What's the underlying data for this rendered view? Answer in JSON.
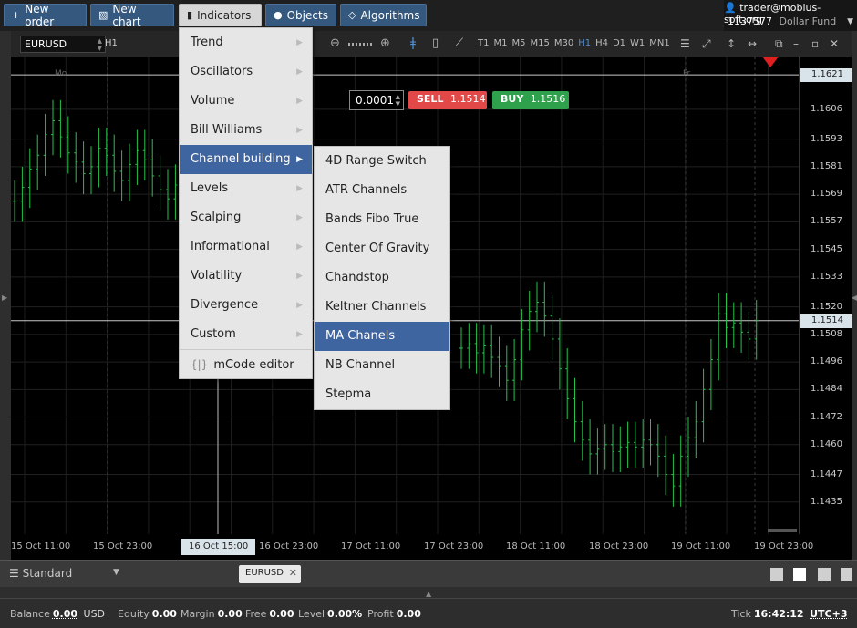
{
  "toolbar": {
    "new_order": "New order",
    "new_chart": "New chart",
    "indicators": "Indicators",
    "objects": "Objects",
    "algorithms": "Algorithms"
  },
  "account": {
    "user": "trader@mobius-soft.org",
    "id": "1137577",
    "fund": "Dollar Fund"
  },
  "chart": {
    "symbol": "EURUSD",
    "timeframe": "H1",
    "timeframes": [
      "T1",
      "M1",
      "M5",
      "M15",
      "M30",
      "H1",
      "H4",
      "D1",
      "W1",
      "MN1"
    ],
    "selected_timeframe": "H1",
    "lot": "0.0001",
    "sell_label": "SELL",
    "sell_price": "1.1514",
    "buy_label": "BUY",
    "buy_price": "1.1516",
    "price_ticks": [
      "1.1606",
      "1.1593",
      "1.1581",
      "1.1569",
      "1.1557",
      "1.1545",
      "1.1533",
      "1.1520",
      "1.1508",
      "1.1496",
      "1.1484",
      "1.1472",
      "1.1460",
      "1.1447",
      "1.1435"
    ],
    "price_tag_high": "1.1621",
    "price_tag_current": "1.1514",
    "time_ticks": [
      "15 Oct 11:00",
      "15 Oct 23:00",
      "16 Oct 23:00",
      "17 Oct 11:00",
      "17 Oct 23:00",
      "18 Oct 11:00",
      "18 Oct 23:00",
      "19 Oct 11:00",
      "19 Oct 23:00"
    ],
    "time_cursor": "16 Oct 15:00",
    "day_labels": [
      "Mo",
      "Fr"
    ],
    "colors": {
      "candle": "#27c24a",
      "sell": "#e24848",
      "buy": "#2fa14c",
      "menu_highlight": "#3f65a0"
    }
  },
  "chart_data": {
    "type": "bar",
    "title": "",
    "symbol": "EURUSD",
    "timeframe": "H1",
    "ylim": [
      1.1425,
      1.1625
    ],
    "x_ticks": [
      "15 Oct 11:00",
      "15 Oct 23:00",
      "16 Oct 23:00",
      "17 Oct 11:00",
      "17 Oct 23:00",
      "18 Oct 11:00",
      "18 Oct 23:00",
      "19 Oct 11:00",
      "19 Oct 23:00"
    ],
    "y_ticks": [
      1.1606,
      1.1593,
      1.1581,
      1.1569,
      1.1557,
      1.1545,
      1.1533,
      1.152,
      1.1508,
      1.1496,
      1.1484,
      1.1472,
      1.146,
      1.1447,
      1.1435
    ],
    "ohlc_close": [
      1.1566,
      1.1572,
      1.158,
      1.1586,
      1.1595,
      1.1601,
      1.1594,
      1.1587,
      1.1583,
      1.1578,
      1.1581,
      1.1589,
      1.1586,
      1.1579,
      1.1575,
      1.1582,
      1.1588,
      1.1584,
      1.1577,
      1.1571,
      1.1567,
      1.1573
    ],
    "ohlc_close_right": [
      1.1502,
      1.1504,
      1.15,
      1.1503,
      1.1498,
      1.1494,
      1.1488,
      1.1497,
      1.151,
      1.1518,
      1.1522,
      1.1516,
      1.1506,
      1.1493,
      1.148,
      1.147,
      1.1462,
      1.1456,
      1.1458,
      1.146,
      1.1457,
      1.1459,
      1.1461,
      1.1459,
      1.1462,
      1.146,
      1.1455,
      1.1447,
      1.1442,
      1.1455,
      1.1463,
      1.147,
      1.1484,
      1.1497,
      1.1517,
      1.1511,
      1.1513,
      1.1509,
      1.1506,
      1.1514
    ],
    "current_price": 1.1514,
    "reference_price": 1.1621
  },
  "menus": {
    "indicators": [
      {
        "label": "Trend"
      },
      {
        "label": "Oscillators"
      },
      {
        "label": "Volume"
      },
      {
        "label": "Bill Williams"
      },
      {
        "label": "Channel building"
      },
      {
        "label": "Levels"
      },
      {
        "label": "Scalping"
      },
      {
        "label": "Informational"
      },
      {
        "label": "Volatility"
      },
      {
        "label": "Divergence"
      },
      {
        "label": "Custom"
      }
    ],
    "indicators_selected": "Channel building",
    "mcode": "mCode editor",
    "channel_building": [
      {
        "label": "4D Range Switch"
      },
      {
        "label": "ATR Channels"
      },
      {
        "label": "Bands Fibo True"
      },
      {
        "label": "Center Of Gravity"
      },
      {
        "label": "Chandstop"
      },
      {
        "label": "Keltner Channels"
      },
      {
        "label": "MA Chanels"
      },
      {
        "label": "NB Channel"
      },
      {
        "label": "Stepma"
      }
    ],
    "channel_selected": "MA Chanels"
  },
  "tabs": {
    "layout": "Standard",
    "symbol_tab": "EURUSD"
  },
  "status": {
    "balance_label": "Balance",
    "balance": "0.00",
    "currency": "USD",
    "equity_label": "Equity",
    "equity": "0.00",
    "margin_label": "Margin",
    "margin": "0.00",
    "free_label": "Free",
    "free": "0.00",
    "level_label": "Level",
    "level": "0.00%",
    "profit_label": "Profit",
    "profit": "0.00",
    "tick_label": "Tick",
    "tick_time": "16:42:12",
    "timezone": "UTC+3"
  }
}
